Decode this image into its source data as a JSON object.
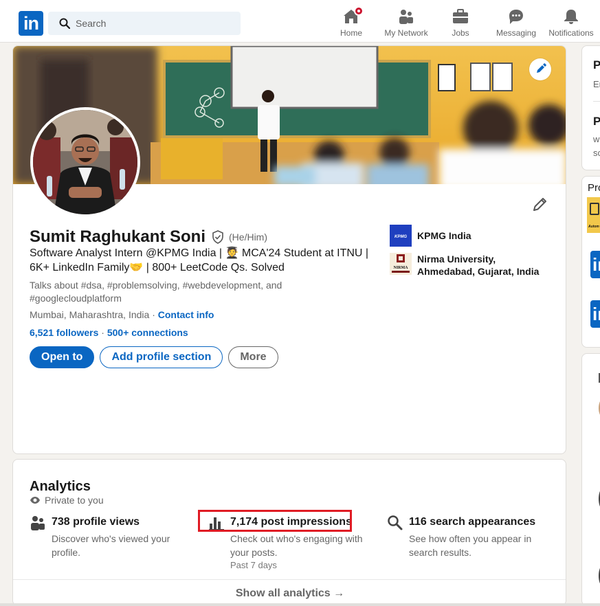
{
  "nav": {
    "logo_text": "in",
    "search_placeholder": "Search",
    "items": [
      {
        "label": "Home",
        "icon": "home-icon"
      },
      {
        "label": "My Network",
        "icon": "network-icon"
      },
      {
        "label": "Jobs",
        "icon": "jobs-icon"
      },
      {
        "label": "Messaging",
        "icon": "messaging-icon"
      },
      {
        "label": "Notifications",
        "icon": "bell-icon"
      }
    ]
  },
  "profile": {
    "name": "Sumit Raghukant Soni",
    "pronouns": "(He/Him)",
    "headline": "Software Analyst Intern @KPMG India | 🧑‍🎓 MCA'24 Student at ITNU | 6K+ LinkedIn Family🤝 | 800+ LeetCode Qs. Solved",
    "talks_about": "Talks about #dsa, #problemsolving, #webdevelopment, and #googlecloudplatform",
    "location": "Mumbai, Maharashtra, India",
    "location_separator": " · ",
    "contact_info": "Contact info",
    "followers": "6,521 followers",
    "connections_separator": " · ",
    "connections": "500+ connections",
    "buttons": {
      "open_to": "Open to",
      "add_section": "Add profile section",
      "more": "More"
    },
    "orgs": [
      {
        "name": "KPMG India",
        "logo_text": "KPMG"
      },
      {
        "name": "Nirma University, Ahmedabad, Gujarat, India",
        "logo_text": "NIRMA"
      }
    ]
  },
  "analytics": {
    "title": "Analytics",
    "private_label": "Private to you",
    "items": [
      {
        "headline": "738 profile views",
        "description": "Discover who's viewed your profile.",
        "icon": "people-icon"
      },
      {
        "headline": "7,174 post impressions",
        "description": "Check out who's engaging with your posts.",
        "sub": "Past 7 days",
        "icon": "bar-chart-icon"
      },
      {
        "headline": "116 search appearances",
        "description": "See how often you appear in search results.",
        "icon": "search-icon"
      }
    ],
    "show_all": "Show all analytics →"
  },
  "rail": {
    "card1_title_a": "P",
    "card1_sub_a": "Er",
    "card1_title_b": "P",
    "card1_sub_b": "w",
    "card1_sub_c": "sc",
    "card2_title": "Pro",
    "card2_logo_text": "Autom"
  },
  "colors": {
    "brand": "#0a66c2",
    "highlight": "#e01b24",
    "notification": "#cb112d"
  }
}
